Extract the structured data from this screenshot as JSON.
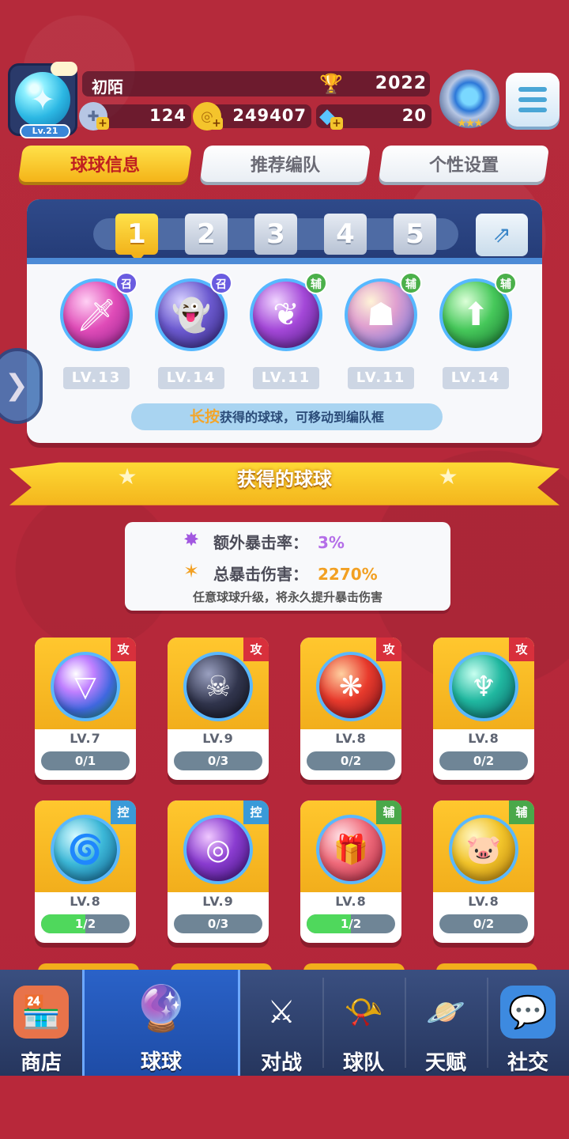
{
  "player": {
    "name": "初陌",
    "level": "Lv.21",
    "trophies": "2022",
    "resource1": "124",
    "coins": "249407",
    "gems": "20"
  },
  "tabs": [
    {
      "label": "球球信息",
      "active": true
    },
    {
      "label": "推荐编队",
      "active": false
    },
    {
      "label": "个性设置",
      "active": false
    }
  ],
  "team": {
    "slots": [
      "1",
      "2",
      "3",
      "4",
      "5"
    ],
    "active_slot": "1",
    "balls": [
      {
        "role": "召",
        "level": "LV.13",
        "icon": "sword-icon"
      },
      {
        "role": "召",
        "level": "LV.14",
        "icon": "ghost-icon"
      },
      {
        "role": "辅",
        "level": "LV.11",
        "icon": "leaf-icon"
      },
      {
        "role": "辅",
        "level": "LV.11",
        "icon": "figures-icon"
      },
      {
        "role": "辅",
        "level": "LV.14",
        "icon": "arrow-up-icon"
      }
    ],
    "hint_emphasis": "长按",
    "hint_text": "获得的球球，可移动到编队框"
  },
  "section_title": "获得的球球",
  "crit": {
    "extra_rate_label": "额外暴击率：",
    "extra_rate_value": "3%",
    "total_damage_label": "总暴击伤害：",
    "total_damage_value": "2270%",
    "note": "任意球球升级，将永久提升暴击伤害"
  },
  "cards": [
    {
      "tag": "攻",
      "level": "LV.7",
      "progress": "0/1",
      "fraction": 0,
      "icon": "prism-icon"
    },
    {
      "tag": "攻",
      "level": "LV.9",
      "progress": "0/3",
      "fraction": 0,
      "icon": "venom-icon"
    },
    {
      "tag": "攻",
      "level": "LV.8",
      "progress": "0/2",
      "fraction": 0,
      "icon": "phoenix-icon"
    },
    {
      "tag": "攻",
      "level": "LV.8",
      "progress": "0/2",
      "fraction": 0,
      "icon": "trident-icon"
    },
    {
      "tag": "控",
      "level": "LV.8",
      "progress": "1/2",
      "fraction": 0.5,
      "icon": "swirl-icon"
    },
    {
      "tag": "控",
      "level": "LV.9",
      "progress": "0/3",
      "fraction": 0,
      "icon": "portal-icon"
    },
    {
      "tag": "辅",
      "level": "LV.8",
      "progress": "1/2",
      "fraction": 0.5,
      "icon": "gift-icon"
    },
    {
      "tag": "辅",
      "level": "LV.8",
      "progress": "0/2",
      "fraction": 0,
      "icon": "piggy-bank-icon"
    }
  ],
  "nav": [
    {
      "label": "商店",
      "icon": "shop-icon",
      "active": false
    },
    {
      "label": "球球",
      "icon": "balls-icon",
      "active": true
    },
    {
      "label": "对战",
      "icon": "crossed-swords-icon",
      "active": false
    },
    {
      "label": "球队",
      "icon": "whistle-icon",
      "active": false
    },
    {
      "label": "天赋",
      "icon": "planet-icon",
      "active": false
    },
    {
      "label": "社交",
      "icon": "chat-heart-icon",
      "active": false
    }
  ],
  "colors": {
    "background": "#b8283a",
    "accent_yellow": "#f4b418",
    "nav_active": "#1e4ca6",
    "progress_fill": "#4fd85c"
  }
}
